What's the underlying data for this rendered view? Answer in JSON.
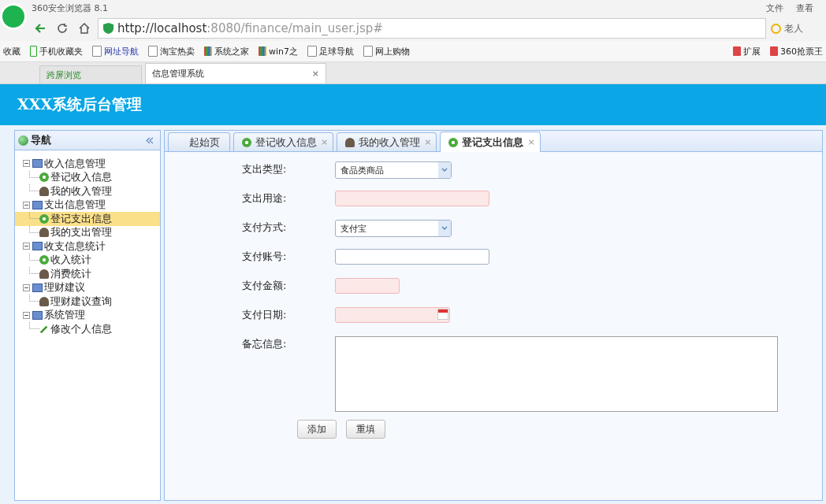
{
  "browser": {
    "title": "360安全浏览器 8.1",
    "menu": [
      "文件",
      "查看"
    ],
    "url_host": "http://localhost",
    "url_rest": ":8080/finance/main_user.jsp#",
    "search_text": "老人",
    "bookmarks": [
      {
        "label": "收藏",
        "kind": "star"
      },
      {
        "label": "手机收藏夹",
        "kind": "phone"
      },
      {
        "label": "网址导航",
        "kind": "page"
      },
      {
        "label": "淘宝热卖",
        "kind": "page"
      },
      {
        "label": "系统之家",
        "kind": "win"
      },
      {
        "label": "win7之",
        "kind": "win"
      },
      {
        "label": "足球导航",
        "kind": "page"
      },
      {
        "label": "网上购物",
        "kind": "page"
      }
    ],
    "extensions": [
      {
        "label": "扩展"
      },
      {
        "label": "360抢票王"
      }
    ],
    "tabs": [
      {
        "label": "跨屏浏览",
        "selected": false
      },
      {
        "label": "信息管理系统",
        "selected": true
      }
    ]
  },
  "app": {
    "title": "XXX系统后台管理"
  },
  "sidebar": {
    "title": "导航",
    "tree": [
      {
        "label": "收入信息管理",
        "children": [
          {
            "label": "登记收入信息",
            "kind": "add",
            "selected": false
          },
          {
            "label": "我的收入管理",
            "kind": "user",
            "selected": false
          }
        ]
      },
      {
        "label": "支出信息管理",
        "children": [
          {
            "label": "登记支出信息",
            "kind": "add",
            "selected": true
          },
          {
            "label": "我的支出管理",
            "kind": "user",
            "selected": false
          }
        ]
      },
      {
        "label": "收支信息统计",
        "children": [
          {
            "label": "收入统计",
            "kind": "add",
            "selected": false
          },
          {
            "label": "消费统计",
            "kind": "user",
            "selected": false
          }
        ]
      },
      {
        "label": "理财建议",
        "children": [
          {
            "label": "理财建议查询",
            "kind": "user",
            "selected": false
          }
        ]
      },
      {
        "label": "系统管理",
        "children": [
          {
            "label": "修改个人信息",
            "kind": "edit",
            "selected": false
          }
        ]
      }
    ]
  },
  "tabs": [
    {
      "label": "起始页",
      "kind": "home",
      "selected": false
    },
    {
      "label": "登记收入信息",
      "kind": "add",
      "selected": false
    },
    {
      "label": "我的收入管理",
      "kind": "user",
      "selected": false
    },
    {
      "label": "登记支出信息",
      "kind": "add",
      "selected": true
    }
  ],
  "close_glyph": "×",
  "form": {
    "fields": [
      {
        "label": "支出类型:",
        "kind": "select",
        "value": "食品类商品",
        "invalid": false
      },
      {
        "label": "支出用途:",
        "kind": "text",
        "invalid": true
      },
      {
        "label": "支付方式:",
        "kind": "select",
        "value": "支付宝",
        "invalid": false
      },
      {
        "label": "支付账号:",
        "kind": "text",
        "invalid": false
      },
      {
        "label": "支付金额:",
        "kind": "amount",
        "invalid": true
      },
      {
        "label": "支付日期:",
        "kind": "date",
        "invalid": true
      },
      {
        "label": "备忘信息:",
        "kind": "textarea",
        "invalid": false
      }
    ],
    "buttons": [
      "添加",
      "重填"
    ]
  }
}
